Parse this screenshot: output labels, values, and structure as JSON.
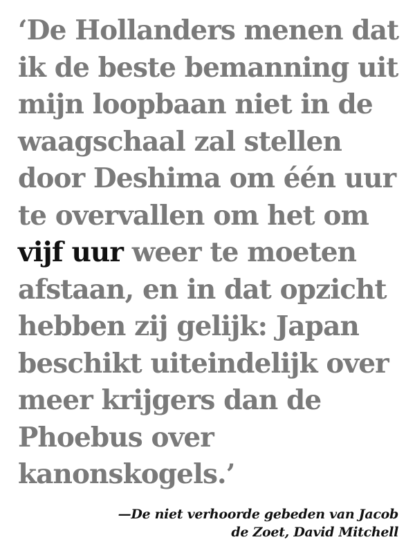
{
  "quote": {
    "lines": [
      "‘De Hollanders menen dat",
      "ik de beste bemanning uit",
      "mijn loopbaan niet in de",
      "waagschaal zal stellen",
      "door Deshima om één uur",
      "te overvallen om het om",
      "weer te moeten",
      "afstaan, en in dat opzicht",
      "hebben zij gelijk: Japan",
      "beschikt uiteindelijk over",
      "meer krijgers dan de",
      "Phoebus over",
      "kanonskogels.’"
    ],
    "highlight": "vijf uur"
  },
  "attribution": {
    "line1": "—De niet verhoorde gebeden van Jacob",
    "line2": "de Zoet, David Mitchell"
  },
  "colors": {
    "quote_text": "#7a7a7a",
    "highlight_text": "#111111",
    "attribution_text": "#111111",
    "background": "#ffffff"
  }
}
